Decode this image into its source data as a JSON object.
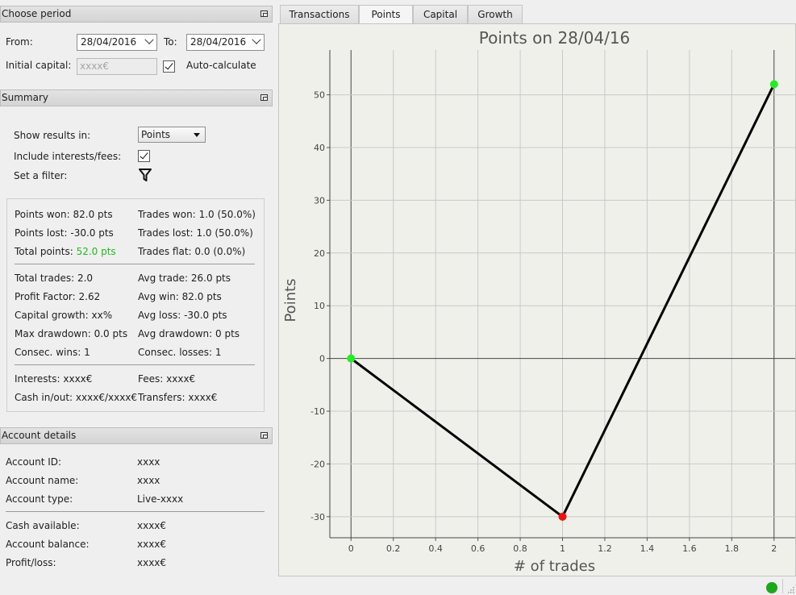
{
  "period_panel": {
    "title": "Choose period",
    "from_label": "From:",
    "from_value": "28/04/2016",
    "to_label": "To:",
    "to_value": "28/04/2016",
    "initial_capital_label": "Initial capital:",
    "initial_capital_placeholder": "xxxx€",
    "auto_calculate_label": "Auto-calculate",
    "auto_calculate_checked": true
  },
  "summary_panel": {
    "title": "Summary",
    "show_results_label": "Show results in:",
    "show_results_value": "Points",
    "include_interests_label": "Include interests/fees:",
    "include_interests_checked": true,
    "filter_label": "Set a filter:",
    "stats": {
      "points_won_label": "Points won:",
      "points_won_value": "82.0 pts",
      "trades_won_label": "Trades won:",
      "trades_won_value": "1.0 (50.0%)",
      "points_lost_label": "Points lost:",
      "points_lost_value": "-30.0 pts",
      "trades_lost_label": "Trades lost:",
      "trades_lost_value": "1.0 (50.0%)",
      "total_points_label": "Total points:",
      "total_points_value": "52.0 pts",
      "trades_flat_label": "Trades flat:",
      "trades_flat_value": "0.0 (0.0%)",
      "total_trades_label": "Total trades:",
      "total_trades_value": "2.0",
      "avg_trade_label": "Avg trade:",
      "avg_trade_value": "26.0 pts",
      "profit_factor_label": "Profit Factor:",
      "profit_factor_value": "2.62",
      "avg_win_label": "Avg win:",
      "avg_win_value": "82.0 pts",
      "capital_growth_label": "Capital growth:",
      "capital_growth_value": "xx%",
      "avg_loss_label": "Avg loss:",
      "avg_loss_value": "-30.0 pts",
      "max_drawdown_label": "Max drawdown:",
      "max_drawdown_value": "0.0 pts",
      "avg_drawdown_label": "Avg drawdown:",
      "avg_drawdown_value": "0 pts",
      "consec_wins_label": "Consec. wins:",
      "consec_wins_value": "1",
      "consec_losses_label": "Consec. losses:",
      "consec_losses_value": "1",
      "interests_label": "Interests:",
      "interests_value": "xxxx€",
      "fees_label": "Fees:",
      "fees_value": "xxxx€",
      "cash_inout_label": "Cash in/out:",
      "cash_inout_value": "xxxx€/xxxx€",
      "transfers_label": "Transfers:",
      "transfers_value": "xxxx€"
    }
  },
  "account_panel": {
    "title": "Account details",
    "account_id_label": "Account ID:",
    "account_id_value": "xxxx",
    "account_name_label": "Account name:",
    "account_name_value": "xxxx",
    "account_type_label": "Account type:",
    "account_type_value": "Live-xxxx",
    "cash_available_label": "Cash available:",
    "cash_available_value": "xxxx€",
    "account_balance_label": "Account balance:",
    "account_balance_value": "xxxx€",
    "profit_loss_label": "Profit/loss:",
    "profit_loss_value": "xxxx€"
  },
  "tabs": [
    {
      "label": "Transactions",
      "active": false
    },
    {
      "label": "Points",
      "active": true
    },
    {
      "label": "Capital",
      "active": false
    },
    {
      "label": "Growth",
      "active": false
    }
  ],
  "colors": {
    "positive": "#22bb22",
    "point_win": "#22ee22",
    "point_loss": "#ee1111",
    "status_ok": "#1aa81a"
  },
  "chart_data": {
    "type": "line",
    "title": "Points on 28/04/16",
    "xlabel": "# of trades",
    "ylabel": "Points",
    "x": [
      0,
      1,
      2
    ],
    "y": [
      0,
      -30,
      52
    ],
    "point_colors": [
      "#22ee22",
      "#ee1111",
      "#22ee22"
    ],
    "xlim": [
      -0.1,
      2.1
    ],
    "ylim": [
      -34,
      58.5
    ],
    "xticks": [
      "0",
      "0.2",
      "0.4",
      "0.6",
      "0.8",
      "1",
      "1.2",
      "1.4",
      "1.6",
      "1.8",
      "2"
    ],
    "yticks": [
      "-30",
      "-20",
      "-10",
      "0",
      "10",
      "20",
      "30",
      "40",
      "50"
    ],
    "grid": true
  }
}
